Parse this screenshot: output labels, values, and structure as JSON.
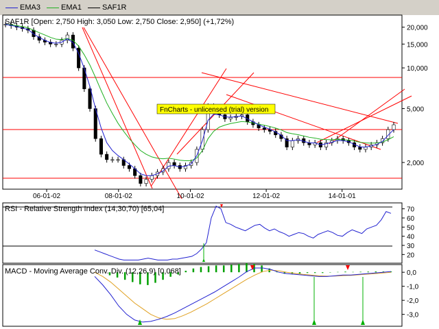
{
  "legend": [
    {
      "label": "EMA3",
      "color": "#2020d0"
    },
    {
      "label": "EMA1",
      "color": "#20b020"
    },
    {
      "label": "SAF1R",
      "color": "#000000"
    }
  ],
  "price_panel": {
    "title": "SAF1R [Open: 2,750  High: 3,050  Low: 2,750  Close: 2,950] (+1,72%)",
    "y_ticks": [
      "20,000",
      "15,000",
      "10,000",
      "5,000",
      "2,000"
    ],
    "x_ticks": [
      "06-01-02",
      "08-01-02",
      "10-01-02",
      "12-01-02",
      "14-01-01"
    ],
    "watermark": "FnCharts - unlicensed (trial) version"
  },
  "rsi_panel": {
    "title": "RSI - Relative Strength Index (14,30,70) [65,04]",
    "y_ticks": [
      "70",
      "60",
      "50",
      "40",
      "30",
      "20"
    ]
  },
  "macd_panel": {
    "title": "MACD - Moving Average Conv. Div. (12,26,9) [0,068]",
    "y_ticks": [
      "0,0",
      "-1,0",
      "-2,0",
      "-3,0"
    ]
  },
  "colors": {
    "ema_fast": "#2020d0",
    "ema_slow": "#20b020",
    "trend": "#ff0000",
    "rsi_line": "#2020d0",
    "macd_line": "#2020d0",
    "macd_signal": "#e0a020",
    "histogram": "#00a000"
  },
  "chart_data": [
    {
      "type": "candlestick",
      "title": "SAF1R [Open: 2,750  High: 3,050  Low: 2,750  Close: 2,950] (+1,72%)",
      "scale": "log",
      "ylim": [
        1300,
        24000
      ],
      "x_tick_labels": [
        "06-01-02",
        "08-01-02",
        "10-01-02",
        "12-01-02",
        "14-01-01"
      ],
      "close": [
        21000,
        20500,
        20000,
        19500,
        19000,
        17000,
        16000,
        15500,
        15000,
        15000,
        16000,
        17500,
        14000,
        10000,
        7000,
        5000,
        3000,
        2300,
        2100,
        2100,
        2100,
        1900,
        1800,
        1600,
        1400,
        1500,
        1600,
        1700,
        1800,
        2000,
        1900,
        1800,
        1900,
        2000,
        2500,
        3500,
        5200,
        5000,
        4500,
        4200,
        4300,
        4400,
        4500,
        4000,
        3800,
        3600,
        3500,
        3400,
        3200,
        3000,
        2600,
        2900,
        3000,
        2800,
        2700,
        2800,
        2600,
        2800,
        2900,
        3000,
        2900,
        2800,
        2600,
        2500,
        2600,
        2700,
        2800,
        3000,
        3500,
        3800
      ],
      "series": [
        {
          "name": "EMA3",
          "values": [
            21000,
            20600,
            20200,
            19700,
            19200,
            17800,
            16800,
            16000,
            15400,
            15200,
            15500,
            16400,
            15400,
            12800,
            9900,
            7300,
            5000,
            3600,
            2800,
            2450,
            2250,
            2100,
            1950,
            1800,
            1650,
            1600,
            1600,
            1650,
            1730,
            1880,
            1900,
            1850,
            1880,
            1950,
            2250,
            2900,
            4100,
            4550,
            4500,
            4350,
            4320,
            4360,
            4420,
            4200,
            4000,
            3800,
            3650,
            3520,
            3360,
            3180,
            2900,
            2900,
            2950,
            2870,
            2790,
            2790,
            2700,
            2750,
            2820,
            2910,
            2900,
            2850,
            2720,
            2610,
            2600,
            2650,
            2720,
            2860,
            3180,
            3500
          ]
        },
        {
          "name": "EMA1",
          "values": [
            21000,
            20800,
            20500,
            20200,
            19800,
            19000,
            18200,
            17500,
            16800,
            16300,
            16200,
            16500,
            16000,
            14500,
            12500,
            10500,
            8500,
            6800,
            5500,
            4600,
            3900,
            3400,
            3000,
            2700,
            2450,
            2300,
            2200,
            2150,
            2130,
            2150,
            2120,
            2080,
            2060,
            2060,
            2160,
            2450,
            3000,
            3400,
            3650,
            3780,
            3880,
            3950,
            4020,
            3980,
            3920,
            3850,
            3770,
            3690,
            3590,
            3480,
            3330,
            3260,
            3210,
            3140,
            3070,
            3030,
            2970,
            2950,
            2950,
            2960,
            2950,
            2930,
            2880,
            2820,
            2790,
            2780,
            2790,
            2830,
            2950,
            3100
          ]
        }
      ]
    },
    {
      "type": "line",
      "title": "RSI - Relative Strength Index (14,30,70) [65,04]",
      "ylim": [
        12,
        75
      ],
      "y_ticks": [
        70,
        60,
        50,
        40,
        30,
        20
      ],
      "series": [
        {
          "name": "RSI",
          "values": [
            25,
            23,
            21,
            19,
            17,
            15,
            14,
            14,
            14,
            14,
            15,
            16,
            15,
            14,
            14,
            14,
            15,
            15,
            16,
            17,
            18,
            21,
            26,
            33,
            60,
            73,
            70,
            55,
            53,
            50,
            48,
            46,
            49,
            52,
            53,
            49,
            46,
            48,
            45,
            43,
            40,
            42,
            44,
            43,
            40,
            38,
            42,
            44,
            46,
            44,
            41,
            40,
            44,
            47,
            45,
            43,
            48,
            50,
            52,
            58,
            67,
            65
          ]
        }
      ]
    },
    {
      "type": "line",
      "title": "MACD - Moving Average Conv. Div. (12,26,9) [0,068]",
      "ylim": [
        -3.7,
        0.4
      ],
      "y_ticks": [
        0,
        -1,
        -2,
        -3
      ],
      "series": [
        {
          "name": "MACD",
          "values": [
            -0.3,
            -0.9,
            -1.6,
            -2.4,
            -3.0,
            -3.4,
            -3.55,
            -3.5,
            -3.35,
            -3.15,
            -2.9,
            -2.6,
            -2.3,
            -2.0,
            -1.7,
            -1.4,
            -1.05,
            -0.7,
            -0.35,
            0.05,
            0.3,
            0.3,
            0.2,
            0.0,
            -0.1,
            -0.15,
            -0.2,
            -0.25,
            -0.3,
            -0.3,
            -0.25,
            -0.2,
            -0.2,
            -0.15,
            -0.1,
            -0.05,
            0.0,
            0.05
          ]
        },
        {
          "name": "Signal",
          "values": [
            0.0,
            -0.3,
            -0.7,
            -1.2,
            -1.7,
            -2.2,
            -2.6,
            -3.0,
            -3.25,
            -3.35,
            -3.3,
            -3.1,
            -2.85,
            -2.55,
            -2.25,
            -1.9,
            -1.55,
            -1.2,
            -0.85,
            -0.5,
            -0.2,
            0.05,
            0.15,
            0.1,
            0.0,
            -0.08,
            -0.15,
            -0.2,
            -0.25,
            -0.28,
            -0.27,
            -0.24,
            -0.22,
            -0.18,
            -0.14,
            -0.1,
            -0.05,
            0.0
          ]
        },
        {
          "name": "Histogram",
          "values": [
            -0.2,
            -0.35,
            -0.5,
            -0.65,
            -0.8,
            -0.85,
            -0.7,
            -0.5,
            -0.3,
            -0.15,
            0.1,
            0.25,
            0.35,
            0.4,
            0.45,
            0.45,
            0.5,
            0.55,
            0.6,
            0.55,
            0.45,
            0.25,
            0.05,
            -0.1,
            -0.1,
            -0.08,
            -0.05,
            -0.05,
            -0.05,
            -0.02,
            0.02,
            0.04,
            0.02,
            0.03,
            0.04,
            0.05,
            0.05,
            0.05
          ]
        }
      ]
    }
  ]
}
